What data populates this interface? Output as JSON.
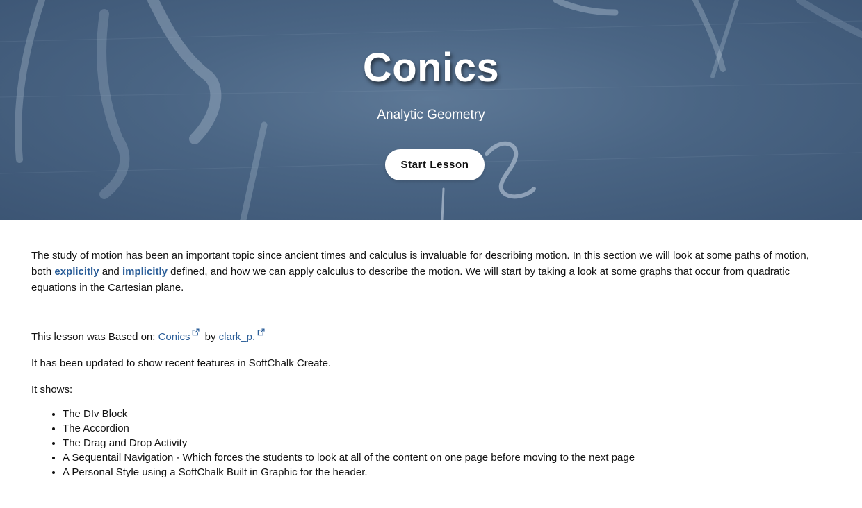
{
  "hero": {
    "title": "Conics",
    "subtitle": "Analytic Geometry",
    "start_button_label": "Start Lesson"
  },
  "content": {
    "intro_part1": "The study of motion has been an important topic since ancient times and calculus is invaluable for describing motion. In this section we will look at some paths of motion, both ",
    "term_explicitly": "explicitly",
    "intro_and": " and ",
    "term_implicitly": "implicitly",
    "intro_part2": " defined, and how we can apply calculus to describe the motion. We will start by taking a look at some graphs that occur from quadratic equations in the Cartesian plane.",
    "based_on_prefix": "This lesson was Based on: ",
    "based_on_link": "Conics",
    "based_on_by": " by ",
    "author_link": "clark_p.",
    "updated_text": "It has been updated to show recent features in SoftChalk Create.",
    "it_shows": "It shows:",
    "features": [
      "The DIv Block",
      "The Accordion",
      "The Drag and Drop Activity",
      "A Sequentail Navigation - Which forces the students to look at all of the content on one page before moving to the next page",
      "A Personal Style using a SoftChalk Built in Graphic for the header."
    ]
  },
  "colors": {
    "hero_background": "#4a6584",
    "link": "#2a5d98",
    "button_background": "#ffffff"
  },
  "icons": {
    "external_link": "external-link-icon"
  }
}
